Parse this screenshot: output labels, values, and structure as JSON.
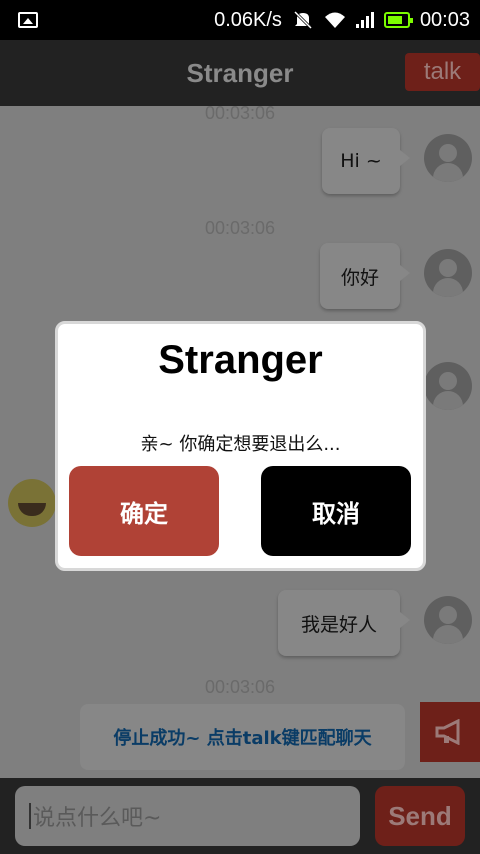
{
  "status_bar": {
    "speed": "0.06K/s",
    "time": "00:03",
    "icons": [
      "image-icon",
      "mute-icon",
      "wifi-icon",
      "signal-icon",
      "battery-icon"
    ]
  },
  "header": {
    "title": "Stranger",
    "talk_label": "talk"
  },
  "messages": [
    {
      "time": "00:03:06",
      "text": "Hi ~"
    },
    {
      "time": "00:03:06",
      "text": "你好"
    },
    {
      "time": "00:03:06",
      "text": "我是好人"
    }
  ],
  "system_message": {
    "time": "00:03:06",
    "text": "停止成功~ 点击talk键匹配聊天"
  },
  "input": {
    "placeholder": "说点什么吧~",
    "send_label": "Send"
  },
  "dialog": {
    "title": "Stranger",
    "message": "亲~ 你确定想要退出么...",
    "confirm_label": "确定",
    "cancel_label": "取消"
  },
  "colors": {
    "accent_red": "#b04236",
    "system_text": "#0a3c66",
    "battery": "#7cfc00"
  }
}
